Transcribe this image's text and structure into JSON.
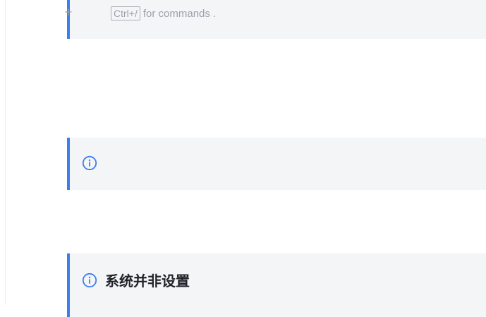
{
  "editor": {
    "top_callout": {
      "add_block_label": "+",
      "shortcut_key": "Ctrl+/",
      "shortcut_suffix": "for commands ."
    },
    "middle_callout": {
      "icon": "info-icon",
      "text": ""
    },
    "bottom_callout": {
      "icon": "info-icon",
      "title": "系统并非设置"
    }
  },
  "colors": {
    "accent": "#3b7ef2",
    "callout_background": "#f4f5f7",
    "placeholder_text": "#9ba1aa",
    "title_text": "#1f2329"
  }
}
